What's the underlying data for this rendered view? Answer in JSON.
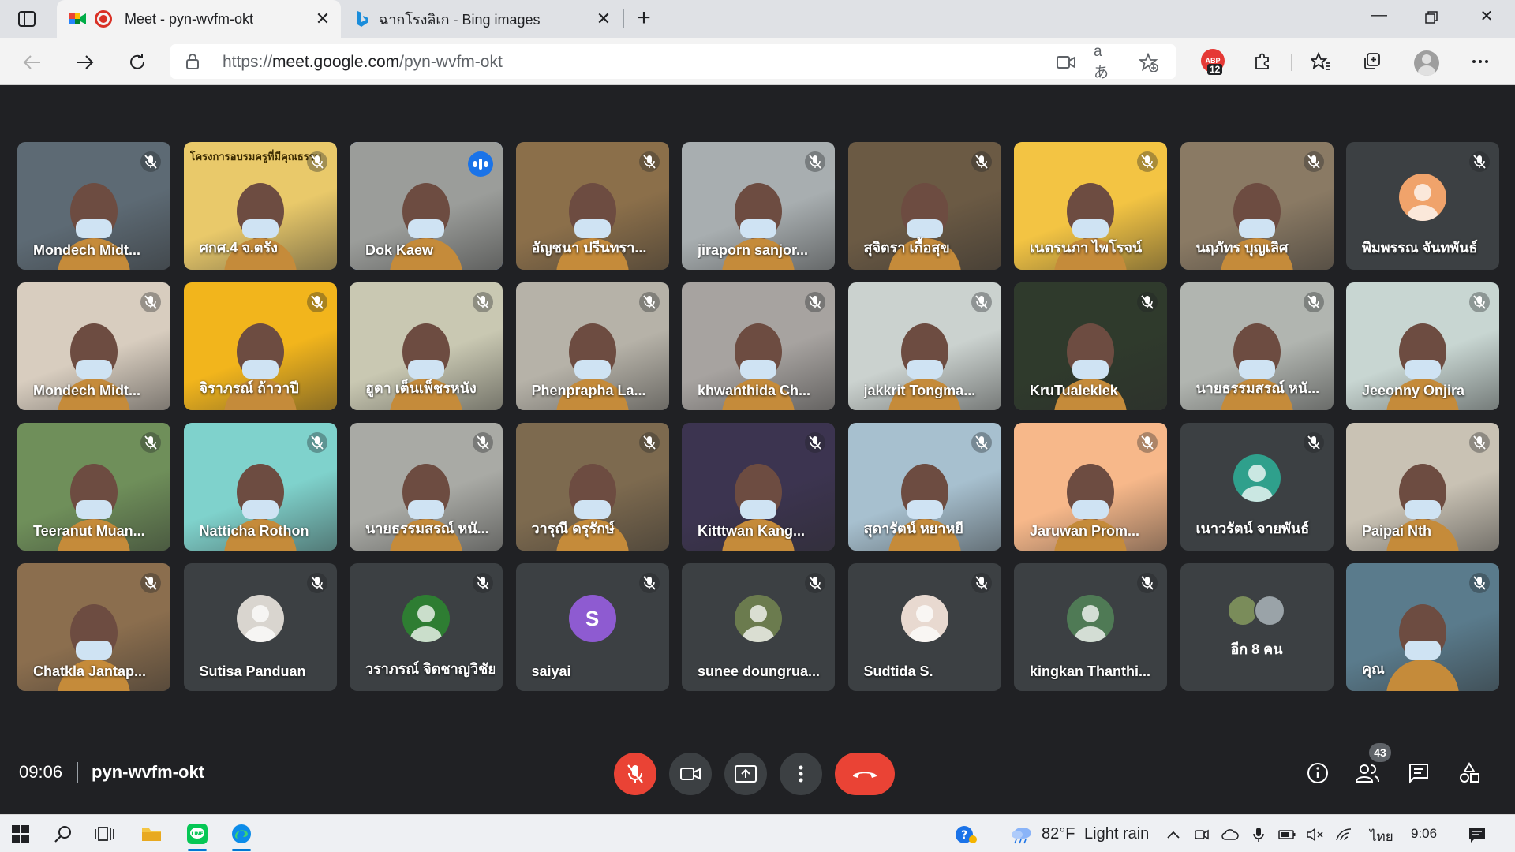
{
  "browser": {
    "tabs": [
      {
        "title": "Meet - pyn-wvfm-okt",
        "active": true
      },
      {
        "title": "ฉากโรงลิเก - Bing images",
        "active": false
      }
    ],
    "url_prefix": "https://",
    "url_host": "meet.google.com",
    "url_path": "/pyn-wvfm-okt",
    "extension_badge": "12",
    "read_aloud_icon": "aあ"
  },
  "participants": [
    {
      "name": "Mondech Midt...",
      "muted": true,
      "kind": "video",
      "bg": "#5d6a74"
    },
    {
      "name": "ศกศ.4 จ.ตรัง",
      "muted": true,
      "kind": "video",
      "bg": "#e9c96a",
      "overlay_text": "โครงการอบรมครูที่มีคุณธรรม"
    },
    {
      "name": "Dok Kaew",
      "muted": false,
      "kind": "video",
      "speaking": true,
      "bg": "#9b9d9a"
    },
    {
      "name": "อัญชนา ปรีนทรา...",
      "muted": true,
      "kind": "video",
      "bg": "#8b6f4a"
    },
    {
      "name": "jiraporn sanjor...",
      "muted": true,
      "kind": "video",
      "bg": "#a8aeb0"
    },
    {
      "name": "สุจิตรา เกื้อสุข",
      "muted": true,
      "kind": "video",
      "bg": "#6b5a44"
    },
    {
      "name": "เนตรนภา ไพโรจน์",
      "muted": true,
      "kind": "video",
      "bg": "#f3c443"
    },
    {
      "name": "นฤภัทร บุญเลิศ",
      "muted": true,
      "kind": "video",
      "bg": "#8a7a64"
    },
    {
      "name": "พิมพรรณ จันทพันธ์",
      "muted": true,
      "kind": "avatar",
      "avatar_color": "#f0a36b"
    },
    {
      "name": "Mondech Midt...",
      "muted": true,
      "kind": "video",
      "bg": "#d8cdbf"
    },
    {
      "name": "จิราภรณ์ ถ้าวาปี",
      "muted": true,
      "kind": "video",
      "bg": "#f2b51c"
    },
    {
      "name": "ฮูดา เต็นเพ็ชรหนัง",
      "muted": true,
      "kind": "video",
      "bg": "#c9c8b2"
    },
    {
      "name": "Phenprapha La...",
      "muted": true,
      "kind": "video",
      "bg": "#b6b2a8"
    },
    {
      "name": "khwanthida Ch...",
      "muted": true,
      "kind": "video",
      "bg": "#a7a3a0"
    },
    {
      "name": "jakkrit Tongma...",
      "muted": true,
      "kind": "video",
      "bg": "#cbd2cf"
    },
    {
      "name": "KruTualeklek",
      "muted": true,
      "kind": "video",
      "bg": "#2f3a2c"
    },
    {
      "name": "นายธรรมสรณ์ หนั...",
      "muted": true,
      "kind": "video",
      "bg": "#b1b5b0"
    },
    {
      "name": "Jeeonny Onjira",
      "muted": true,
      "kind": "video",
      "bg": "#c8d6d2"
    },
    {
      "name": "Teeranut Muan...",
      "muted": true,
      "kind": "video",
      "bg": "#6f8f5a"
    },
    {
      "name": "Natticha Rothon",
      "muted": true,
      "kind": "video",
      "bg": "#7fd2cc"
    },
    {
      "name": "นายธรรมสรณ์ หนั...",
      "muted": true,
      "kind": "video",
      "bg": "#a9aaa5"
    },
    {
      "name": "วารุณี ดรุรักษ์",
      "muted": true,
      "kind": "video",
      "bg": "#7d6a4f"
    },
    {
      "name": "Kitttwan Kang...",
      "muted": true,
      "kind": "video",
      "bg": "#3c3450"
    },
    {
      "name": "สุดารัตน์ หยาหยี",
      "muted": true,
      "kind": "video",
      "bg": "#a7c0cf"
    },
    {
      "name": "Jaruwan Prom...",
      "muted": true,
      "kind": "video",
      "bg": "#f7b88a"
    },
    {
      "name": "เนาวรัตน์ จายพันธ์",
      "muted": true,
      "kind": "avatar",
      "avatar_color": "#2fa08c"
    },
    {
      "name": "Paipai Nth",
      "muted": true,
      "kind": "video",
      "bg": "#c9c2b4"
    },
    {
      "name": "Chatkla Jantap...",
      "muted": true,
      "kind": "video",
      "bg": "#8b6e4e"
    },
    {
      "name": "Sutisa Panduan",
      "muted": true,
      "kind": "avatar",
      "avatar_color": "#d9d5cf"
    },
    {
      "name": "วราภรณ์ จิตชาญวิชัย",
      "muted": true,
      "kind": "avatar",
      "avatar_color": "#2e7d32"
    },
    {
      "name": "saiyai",
      "muted": true,
      "kind": "letter",
      "letter": "S",
      "avatar_color": "#8e5bd1"
    },
    {
      "name": "sunee doungrua...",
      "muted": true,
      "kind": "avatar",
      "avatar_color": "#6b7b4e"
    },
    {
      "name": "Sudtida S.",
      "muted": true,
      "kind": "avatar",
      "avatar_color": "#e8d9d0"
    },
    {
      "name": "kingkan Thanthi...",
      "muted": true,
      "kind": "avatar",
      "avatar_color": "#4f7a55"
    },
    {
      "name": "อีก 8 คน",
      "muted": false,
      "kind": "others"
    },
    {
      "name": "คุณ",
      "muted": true,
      "kind": "video",
      "bg": "#5a7b8c",
      "self": true
    }
  ],
  "meeting": {
    "time": "09:06",
    "code": "pyn-wvfm-okt",
    "people_count": "43"
  },
  "taskbar": {
    "temperature": "82°F",
    "weather": "Light rain",
    "language": "ไทย",
    "time": "9:06"
  },
  "colors": {
    "meet_bg": "#202124",
    "tile_bg": "#3c4043",
    "danger": "#ea4335",
    "speaking": "#1a73e8"
  }
}
